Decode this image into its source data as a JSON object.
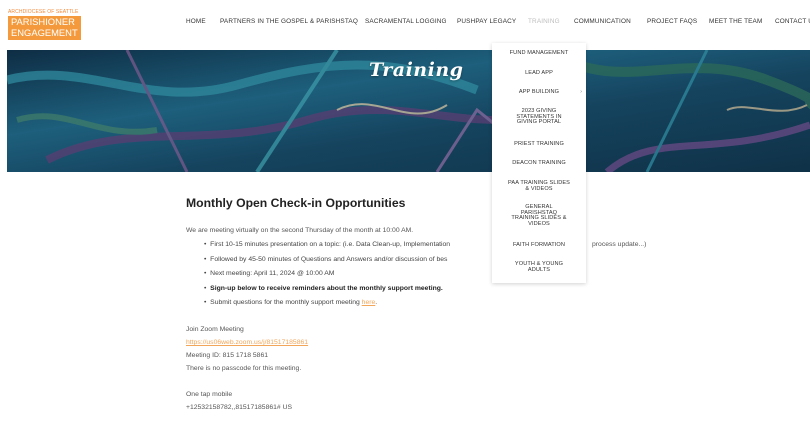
{
  "logo": {
    "top_line": "ARCHDIOCESE OF SEATTLE",
    "line1": "PARISHIONER",
    "line2": "ENGAGEMENT"
  },
  "nav": {
    "items": [
      "HOME",
      "PARTNERS IN THE GOSPEL & PARISHSTAQ",
      "SACRAMENTAL LOGGING",
      "PUSHPAY LEGACY",
      "TRAINING",
      "COMMUNICATION",
      "PROJECT FAQS",
      "MEET THE TEAM",
      "CONTACT US"
    ],
    "active": "TRAINING"
  },
  "hero": {
    "title": "Training",
    "colors": [
      "#0f2f46",
      "#1b5a7a",
      "#2f8a9e",
      "#5a3e73",
      "#2c6b58"
    ]
  },
  "dropdown": {
    "items": [
      {
        "label": [
          "FUND MANAGEMENT"
        ]
      },
      {
        "label": [
          "LEAD APP"
        ]
      },
      {
        "label": [
          "APP BUILDING"
        ],
        "has_submenu": true,
        "arrow": "›"
      },
      {
        "label": [
          "2023 GIVING",
          "STATEMENTS IN",
          "GIVING PORTAL"
        ]
      },
      {
        "label": [
          "PRIEST TRAINING"
        ]
      },
      {
        "label": [
          "DEACON TRAINING"
        ]
      },
      {
        "label": [
          "PAA TRAINING SLIDES",
          "& VIDEOS"
        ]
      },
      {
        "label": [
          "GENERAL",
          "PARISHSTAQ",
          "TRAINING SLIDES &",
          "VIDEOS"
        ]
      },
      {
        "label": [
          "FAITH FORMATION"
        ]
      },
      {
        "label": [
          "YOUTH & YOUNG",
          "ADULTS"
        ]
      }
    ]
  },
  "content": {
    "heading": "Monthly Open Check-in Opportunities",
    "intro": "We are meeting virtually on the second Thursday of the month at 10:00 AM.",
    "bullets": [
      {
        "text": "First 10-15 minutes presentation on a topic: (i.e. Data Clean-up, Implementation",
        "tail": "process update...)"
      },
      {
        "text": "Followed by 45-50 minutes of Questions and Answers and/or discussion of bes",
        "tail": ""
      },
      {
        "text": "Next meeting:   April 11, 2024 @ 10:00 AM",
        "tail": ""
      },
      {
        "text": "Sign-up below to receive reminders about the monthly support meeting.",
        "bold": true
      },
      {
        "text": "Submit questions for the monthly support meeting ",
        "link": "here",
        "after": "."
      }
    ],
    "zoom_title": "Join Zoom Meeting",
    "zoom_link": "https://us06web.zoom.us/j/81517185861",
    "meeting_id": "Meeting ID: 815 1718 5861",
    "passcode": "There is no passcode for this meeting.",
    "one_tap": "One tap mobile",
    "phone": "+12532158782,,81517185861# US"
  }
}
